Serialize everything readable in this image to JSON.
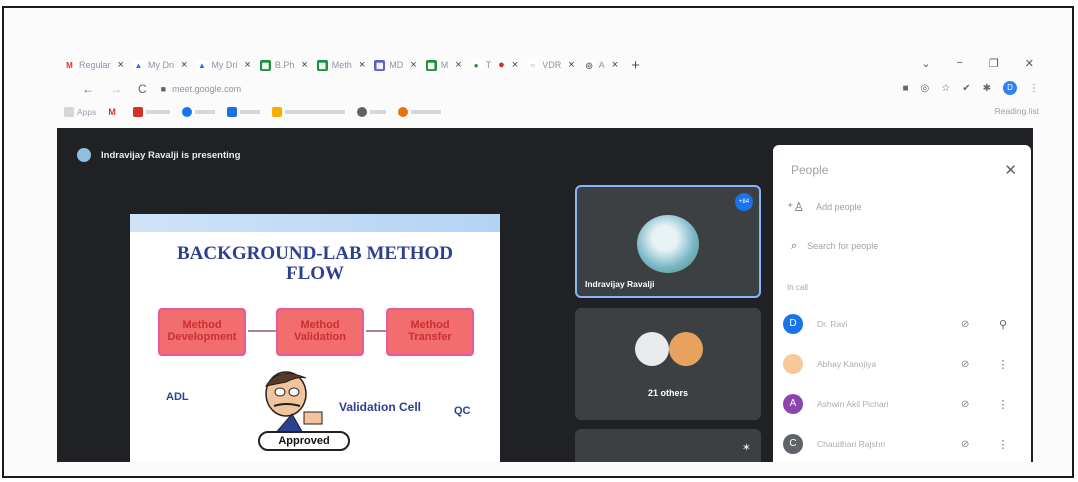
{
  "browser": {
    "tabs": [
      {
        "icon": "M",
        "color": "#d93025",
        "label": "Regular"
      },
      {
        "icon": "▲",
        "color": "#1a73e8",
        "label": "My Dri"
      },
      {
        "icon": "▲",
        "color": "#1a73e8",
        "label": "My Dri"
      },
      {
        "icon": "▦",
        "color": "#1e8e3e",
        "label": "B.Ph"
      },
      {
        "icon": "▦",
        "color": "#1e8e3e",
        "label": "Meth"
      },
      {
        "icon": "▦",
        "color": "#5b5fc7",
        "label": "MD"
      },
      {
        "icon": "▦",
        "color": "#1e8e3e",
        "label": "M"
      },
      {
        "icon": "●",
        "color": "#1e8e3e",
        "label": "T"
      },
      {
        "icon": "○",
        "color": "#9aa0a6",
        "label": "VDR"
      },
      {
        "icon": "◎",
        "color": "#5f6368",
        "label": "A"
      }
    ],
    "new_tab": "+",
    "window_controls": [
      "⌄",
      "−",
      "❐",
      "✕"
    ],
    "url": "meet.google.com",
    "profile": "D",
    "bookmarks": [
      {
        "label": "Apps",
        "color": "#9aa0a6"
      },
      {
        "label": "M",
        "color": "#d93025"
      },
      {
        "label": "",
        "color": "#d93025"
      },
      {
        "label": "",
        "color": "#1a73e8"
      },
      {
        "label": "",
        "color": "#1a73e8"
      },
      {
        "label": "",
        "color": "#f9ab00"
      },
      {
        "label": "",
        "color": "#5f6368"
      },
      {
        "label": "",
        "color": "#e8710a"
      }
    ],
    "reading_list": "Reading list"
  },
  "meet": {
    "presenter_banner": "Indravijay Ravalji is presenting",
    "slide": {
      "title": "BACKGROUND-LAB METHOD FLOW",
      "steps": [
        "Method Development",
        "Method Validation",
        "Method Transfer"
      ],
      "left_label": "ADL",
      "middle_label": "Validation Cell",
      "right_label": "QC",
      "stamp": "Approved"
    },
    "tiles": [
      {
        "name": "Indravijay Ravalji",
        "badge": "+84"
      },
      {
        "name": "21 others"
      }
    ]
  },
  "people_panel": {
    "title": "People",
    "add_people": "Add people",
    "search_placeholder": "Search for people",
    "section": "In call",
    "participants": [
      {
        "initial": "D",
        "color": "#1a73e8",
        "name": "Dr. Ravi"
      },
      {
        "initial": "",
        "color": "#f6c89a",
        "name": "Abhay Kanojiya"
      },
      {
        "initial": "A",
        "color": "#8e44ad",
        "name": "Ashwin Akil Pichari"
      },
      {
        "initial": "C",
        "color": "#5f6368",
        "name": "Chaudhari Rajshri"
      }
    ]
  }
}
